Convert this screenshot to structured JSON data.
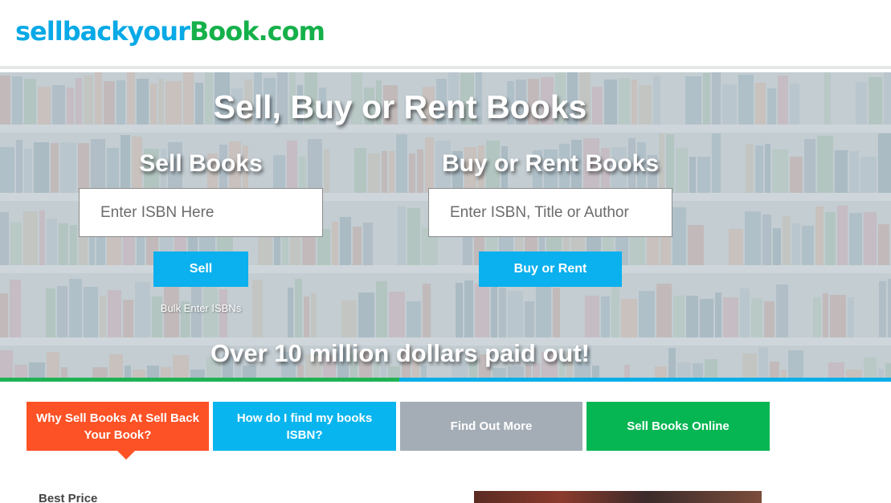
{
  "header": {
    "logo_part1": "sellbackyour",
    "logo_part2": "Book.com"
  },
  "hero": {
    "title": "Sell, Buy or Rent Books",
    "sell": {
      "heading": "Sell Books",
      "placeholder": "Enter ISBN Here",
      "button": "Sell",
      "bulk_link": "Bulk Enter ISBNs"
    },
    "buy": {
      "heading": "Buy or Rent Books",
      "placeholder": "Enter ISBN, Title or Author",
      "button": "Buy or Rent"
    },
    "tagline": "Over 10 million dollars paid out!"
  },
  "tabs": [
    {
      "label": "Why Sell Books At Sell Back Your Book?",
      "color": "#fd5226",
      "active": true
    },
    {
      "label": "How do I find my books ISBN?",
      "color": "#09b5ee"
    },
    {
      "label": "Find Out More",
      "color": "#a4adb5"
    },
    {
      "label": "Sell Books Online",
      "color": "#06b653"
    }
  ],
  "content": {
    "best_price": "Best Price"
  },
  "colors": {
    "brand_blue": "#08a9e6",
    "brand_green": "#15b04a",
    "button_blue": "#0bb0ee"
  }
}
